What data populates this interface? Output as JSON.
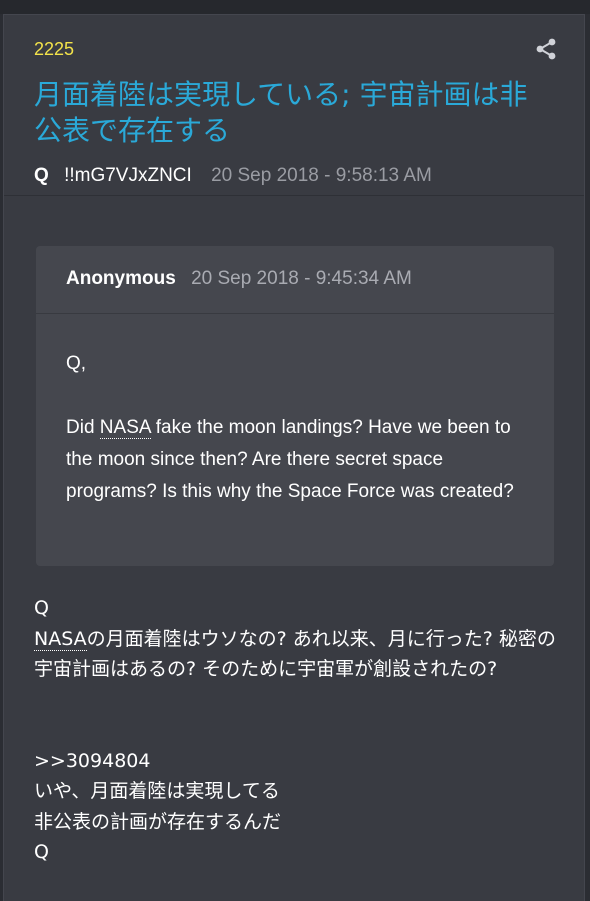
{
  "post": {
    "number": "2225",
    "title": "月面着陸は実現している; 宇宙計画は非公表で存在する",
    "author": "Q",
    "tripcode": "!!mG7VJxZNCI",
    "date": "20 Sep 2018 - 9:58:13 AM",
    "share_icon": "share-icon"
  },
  "quote": {
    "author": "Anonymous",
    "date": "20 Sep 2018 - 9:45:34 AM",
    "line1": "Q,",
    "line2_pre": "Did ",
    "line2_abbr": "NASA",
    "line2_post": " fake the moon landings?  Have we been to the moon since then?  Are there secret space programs?  Is this why the Space Force was created?"
  },
  "reply": {
    "line1": "Q",
    "line2_abbr": "NASA",
    "line2_post": "の月面着陸はウソなの? あれ以来、月に行った? 秘密の宇宙計画はあるの? そのために宇宙軍が創設されたの?",
    "link": ">>3094804",
    "line3": "いや、月面着陸は実現してる",
    "line4": "非公表の計画が存在するんだ",
    "line5": "Q"
  }
}
